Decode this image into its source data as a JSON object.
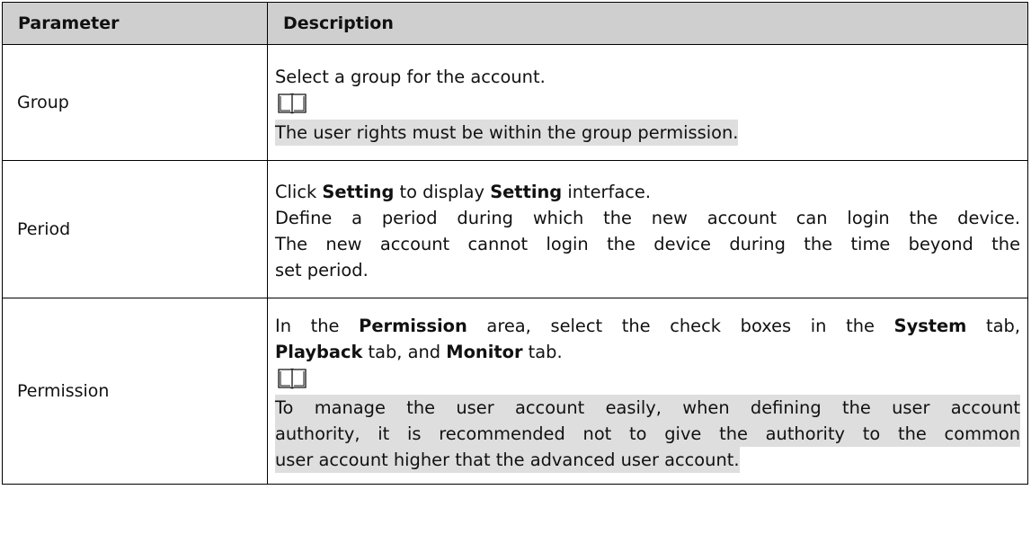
{
  "table": {
    "headers": {
      "parameter": "Parameter",
      "description": "Description"
    },
    "rows": [
      {
        "parameter": "Group",
        "description": {
          "line1": "Select a group for the account.",
          "note_icon": "book-icon",
          "note": "The user rights must be within the group permission."
        }
      },
      {
        "parameter": "Period",
        "description": {
          "l1_a": "Click ",
          "l1_b": "Setting",
          "l1_c": " to display ",
          "l1_d": "Setting",
          "l1_e": " interface.",
          "l2": "Define a period during which the new account can login the device.",
          "l3": "The new account cannot login the device during the time beyond the",
          "l4": "set period."
        }
      },
      {
        "parameter": "Permission",
        "description": {
          "l1_a": "In the ",
          "l1_b": "Permission",
          "l1_c": " area, select the check boxes in the ",
          "l1_d": "System",
          "l1_e": " tab,",
          "l2_a": "Playback",
          "l2_b": " tab, and ",
          "l2_c": "Monitor",
          "l2_d": " tab.",
          "note_icon": "book-icon",
          "note_l1": "To manage the user account easily, when defining the user account",
          "note_l2": "authority, it is recommended not to give the authority to the common",
          "note_l3": "user account higher that the advanced user account."
        }
      }
    ]
  },
  "colors": {
    "header_bg": "#cfcfcf",
    "note_bg": "#dedede",
    "border": "#000000"
  }
}
